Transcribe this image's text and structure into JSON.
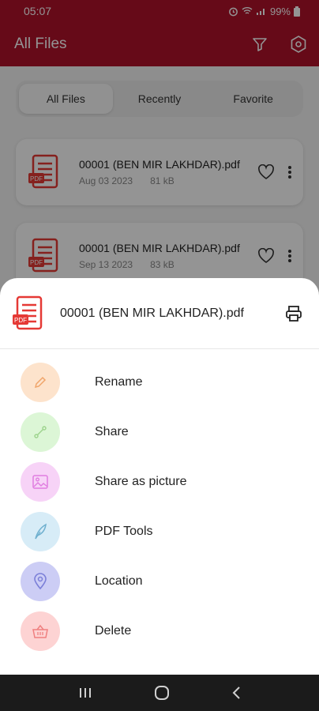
{
  "status": {
    "time": "05:07",
    "battery": "99%"
  },
  "app": {
    "title": "All Files"
  },
  "tabs": [
    {
      "label": "All Files",
      "active": true
    },
    {
      "label": "Recently",
      "active": false
    },
    {
      "label": "Favorite",
      "active": false
    }
  ],
  "files": [
    {
      "name": "00001 (BEN MIR LAKHDAR).pdf",
      "date": "Aug 03 2023",
      "size": "81 kB",
      "badge": "PDF"
    },
    {
      "name": "00001 (BEN MIR LAKHDAR).pdf",
      "date": "Sep 13 2023",
      "size": "83 kB",
      "badge": "PDF"
    }
  ],
  "sheet": {
    "file_name": "00001 (BEN MIR LAKHDAR).pdf",
    "badge": "PDF",
    "actions": [
      {
        "label": "Rename",
        "icon": "pencil-icon",
        "bg": "#fde3cc",
        "fg": "#f0a56a"
      },
      {
        "label": "Share",
        "icon": "share-icon",
        "bg": "#dcf6d6",
        "fg": "#9cd38c"
      },
      {
        "label": "Share as picture",
        "icon": "image-icon",
        "bg": "#f7d3f7",
        "fg": "#e07de0"
      },
      {
        "label": "PDF Tools",
        "icon": "feather-icon",
        "bg": "#d7ecf7",
        "fg": "#6fb0cf"
      },
      {
        "label": "Location",
        "icon": "location-pin-icon",
        "bg": "#cccdf5",
        "fg": "#7b7fd8"
      },
      {
        "label": "Delete",
        "icon": "basket-icon",
        "bg": "#fdd3d3",
        "fg": "#f08080"
      }
    ]
  },
  "colors": {
    "brand": "#b0122a",
    "pdf_red": "#e53935"
  }
}
